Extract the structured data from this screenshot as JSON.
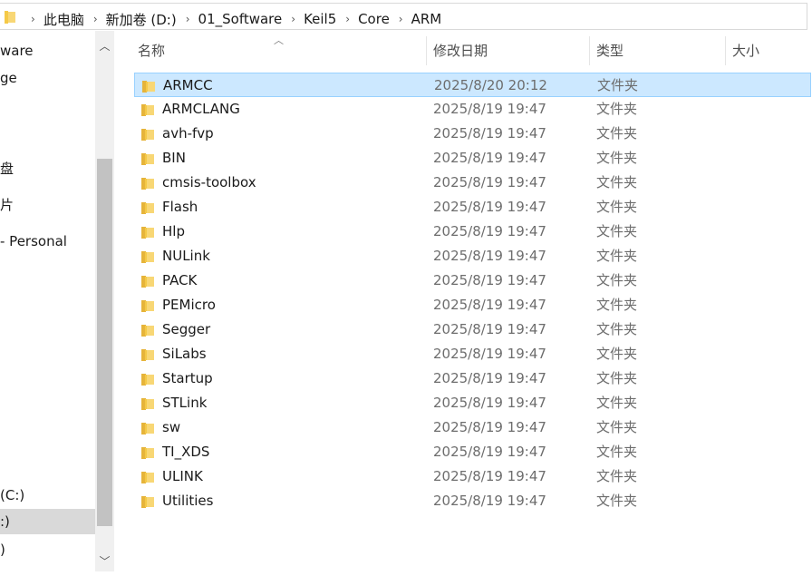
{
  "breadcrumb": {
    "items": [
      "此电脑",
      "新加卷 (D:)",
      "01_Software",
      "Keil5",
      "Core",
      "ARM"
    ]
  },
  "nav": {
    "items": [
      {
        "label": "ware"
      },
      {
        "label": "ge"
      },
      {
        "label": "盘"
      },
      {
        "label": "片"
      },
      {
        "label": "- Personal"
      },
      {
        "label": "(C:)"
      },
      {
        "label": ":)"
      },
      {
        "label": ")"
      }
    ]
  },
  "columns": {
    "name": "名称",
    "date": "修改日期",
    "type": "类型",
    "size": "大小"
  },
  "files": [
    {
      "name": "ARMCC",
      "date": "2025/8/20 20:12",
      "type": "文件夹"
    },
    {
      "name": "ARMCLANG",
      "date": "2025/8/19 19:47",
      "type": "文件夹"
    },
    {
      "name": "avh-fvp",
      "date": "2025/8/19 19:47",
      "type": "文件夹"
    },
    {
      "name": "BIN",
      "date": "2025/8/19 19:47",
      "type": "文件夹"
    },
    {
      "name": "cmsis-toolbox",
      "date": "2025/8/19 19:47",
      "type": "文件夹"
    },
    {
      "name": "Flash",
      "date": "2025/8/19 19:47",
      "type": "文件夹"
    },
    {
      "name": "Hlp",
      "date": "2025/8/19 19:47",
      "type": "文件夹"
    },
    {
      "name": "NULink",
      "date": "2025/8/19 19:47",
      "type": "文件夹"
    },
    {
      "name": "PACK",
      "date": "2025/8/19 19:47",
      "type": "文件夹"
    },
    {
      "name": "PEMicro",
      "date": "2025/8/19 19:47",
      "type": "文件夹"
    },
    {
      "name": "Segger",
      "date": "2025/8/19 19:47",
      "type": "文件夹"
    },
    {
      "name": "SiLabs",
      "date": "2025/8/19 19:47",
      "type": "文件夹"
    },
    {
      "name": "Startup",
      "date": "2025/8/19 19:47",
      "type": "文件夹"
    },
    {
      "name": "STLink",
      "date": "2025/8/19 19:47",
      "type": "文件夹"
    },
    {
      "name": "sw",
      "date": "2025/8/19 19:47",
      "type": "文件夹"
    },
    {
      "name": "TI_XDS",
      "date": "2025/8/19 19:47",
      "type": "文件夹"
    },
    {
      "name": "ULINK",
      "date": "2025/8/19 19:47",
      "type": "文件夹"
    },
    {
      "name": "Utilities",
      "date": "2025/8/19 19:47",
      "type": "文件夹"
    }
  ],
  "selected_file": "ARMCC",
  "colors": {
    "folder": "#f5c947",
    "selection": "#cce8ff",
    "selection_border": "#99d1ff"
  },
  "icons": {
    "folder": "folder-icon",
    "chevron": "chevron-right-icon",
    "sort": "sort-ascending-icon"
  }
}
